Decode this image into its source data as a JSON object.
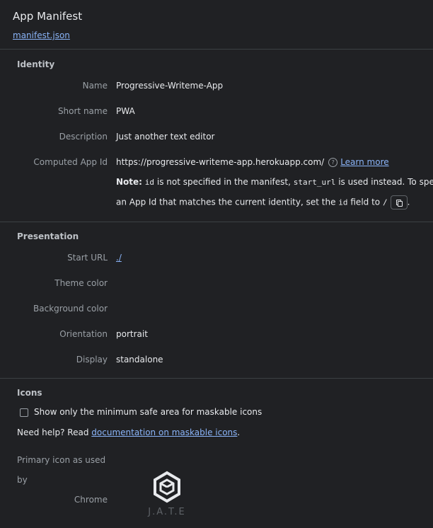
{
  "header": {
    "title": "App Manifest",
    "manifest_link": "manifest.json"
  },
  "identity": {
    "title": "Identity",
    "name_label": "Name",
    "name_value": "Progressive-Writeme-App",
    "short_name_label": "Short name",
    "short_name_value": "PWA",
    "description_label": "Description",
    "description_value": "Just another text editor",
    "computed_id_label": "Computed App Id",
    "computed_id_value": "https://progressive-writeme-app.herokuapp.com/",
    "learn_more": "Learn more",
    "note_bold": "Note:",
    "note_code_id": "id",
    "note_text_1": "is not specified in the manifest,",
    "note_code_start_url": "start_url",
    "note_text_2": "is used instead. To specify",
    "note_text_3": "an App Id that matches the current identity, set the",
    "note_code_id2": "id",
    "note_text_4": "field to",
    "note_code_slash": "/",
    "note_end": "."
  },
  "presentation": {
    "title": "Presentation",
    "start_url_label": "Start URL",
    "start_url_value": "./",
    "theme_color_label": "Theme color",
    "background_color_label": "Background color",
    "orientation_label": "Orientation",
    "orientation_value": "portrait",
    "display_label": "Display",
    "display_value": "standalone"
  },
  "icons": {
    "title": "Icons",
    "maskable_checkbox_label": "Show only the minimum safe area for maskable icons",
    "help_text": "Need help? Read",
    "help_link": "documentation on maskable icons",
    "help_end": ".",
    "primary_icon_label_1": "Primary icon as used by",
    "primary_icon_label_2": "Chrome",
    "logo_text": "J.A.T.E"
  },
  "colors": {
    "background": "#202124",
    "link": "#8ab4f8",
    "divider": "#3c4043"
  }
}
